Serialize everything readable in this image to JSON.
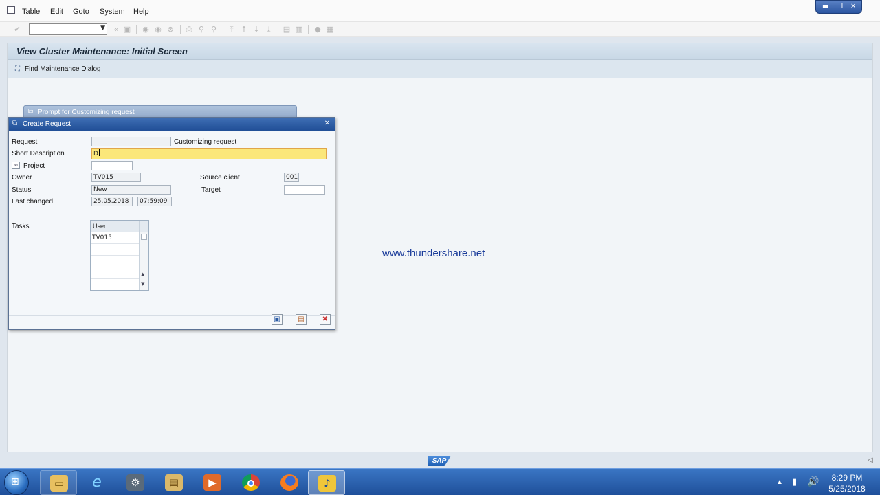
{
  "menubar": {
    "items": [
      "Table",
      "Edit",
      "Goto",
      "System",
      "Help"
    ]
  },
  "window_controls": [
    "minimize-icon",
    "restore-icon",
    "close-icon"
  ],
  "toolbar": {
    "command_field_value": "",
    "icons": [
      "enter-icon",
      "save-icon",
      "back-icon",
      "exit-icon",
      "cancel-icon",
      "print-icon",
      "find-icon",
      "find-next-icon",
      "first-page-icon",
      "previous-page-icon",
      "next-page-icon",
      "last-page-icon",
      "create-session-icon",
      "shortcut-icon",
      "help-icon",
      "layout-icon"
    ]
  },
  "screen": {
    "title": "View Cluster Maintenance: Initial Screen",
    "app_toolbar": {
      "find_dialog_label": "Find Maintenance Dialog"
    }
  },
  "prompt_dialog": {
    "title": "Prompt for Customizing request"
  },
  "create_request": {
    "title": "Create Request",
    "request": {
      "label": "Request",
      "value": "",
      "type_text": "Customizing request"
    },
    "short_description": {
      "label": "Short Description",
      "value": "D"
    },
    "project": {
      "label": "Project",
      "value": ""
    },
    "owner": {
      "label": "Owner",
      "value": "TV015"
    },
    "status": {
      "label": "Status",
      "value": "New"
    },
    "last_changed": {
      "label": "Last changed",
      "date": "25.05.2018",
      "time": "07:59:09"
    },
    "source_client": {
      "label": "Source client",
      "value": "001"
    },
    "target": {
      "label": "Target",
      "value": ""
    },
    "tasks": {
      "label": "Tasks",
      "column_header": "User",
      "rows": [
        "TV015",
        "",
        "",
        "",
        ""
      ]
    },
    "buttons": [
      "save-icon",
      "own-requests-icon",
      "cancel-icon"
    ]
  },
  "watermark": "www.thundershare.net",
  "sap_logo_text": "SAP",
  "taskbar": {
    "apps": [
      "explorer-icon",
      "internet-explorer-icon",
      "sap-gui-icon",
      "file-manager-icon",
      "media-player-icon",
      "chrome-icon",
      "firefox-icon",
      "sap-logon-icon"
    ],
    "clock_time": "8:29 PM",
    "clock_date": "5/25/2018"
  },
  "colors": {
    "dialog_title": "#2a5aa3",
    "active_field": "#fbe77a",
    "watermark": "#1a3b9a",
    "taskbar": "#2b62b0"
  }
}
